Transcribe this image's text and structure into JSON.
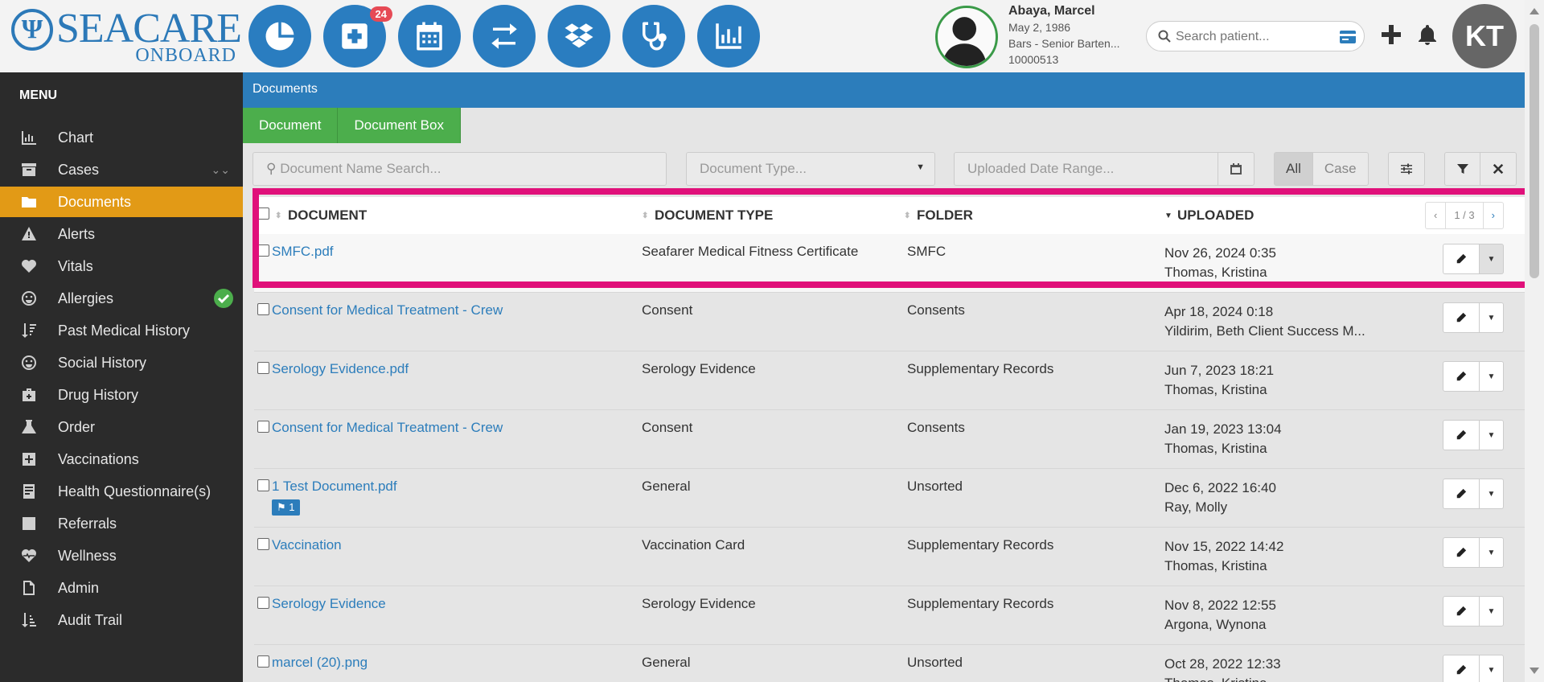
{
  "app": {
    "logo_main": "SEACARE",
    "logo_sub": "ONBOARD",
    "logo_mark": "Ψ",
    "nav_icons": [
      "pie-chart-icon",
      "medical-plus-icon",
      "calendar-icon",
      "transfer-icon",
      "dropbox-icon",
      "stethoscope-icon",
      "bar-chart-icon"
    ],
    "medical_badge_count": "24"
  },
  "patient": {
    "name": "Abaya, Marcel",
    "dob": "May 2, 1986",
    "position": "Bars - Senior Barten...",
    "id": "10000513"
  },
  "header": {
    "search_placeholder": "Search patient...",
    "avatar_initials": "KT"
  },
  "sidebar": {
    "title": "MENU",
    "items": [
      {
        "label": "Chart",
        "icon": "chart-icon"
      },
      {
        "label": "Cases",
        "icon": "archive-icon"
      },
      {
        "label": "Documents",
        "icon": "folder-icon"
      },
      {
        "label": "Alerts",
        "icon": "warning-icon"
      },
      {
        "label": "Vitals",
        "icon": "heart-icon"
      },
      {
        "label": "Allergies",
        "icon": "smile-icon"
      },
      {
        "label": "Past Medical History",
        "icon": "sort-icon"
      },
      {
        "label": "Social History",
        "icon": "smile-icon"
      },
      {
        "label": "Drug History",
        "icon": "medkit-icon"
      },
      {
        "label": "Order",
        "icon": "flask-icon"
      },
      {
        "label": "Vaccinations",
        "icon": "plus-square-icon"
      },
      {
        "label": "Health Questionnaire(s)",
        "icon": "form-icon"
      },
      {
        "label": "Referrals",
        "icon": "referral-icon"
      },
      {
        "label": "Wellness",
        "icon": "heartbeat-icon"
      },
      {
        "label": "Admin",
        "icon": "file-icon"
      },
      {
        "label": "Audit Trail",
        "icon": "sort-amount-icon"
      }
    ]
  },
  "breadcrumb": "Documents",
  "tabs": [
    "Document",
    "Document Box"
  ],
  "filters": {
    "name_placeholder": "Document Name Search...",
    "type_placeholder": "Document Type...",
    "date_placeholder": "Uploaded Date Range...",
    "scope_all": "All",
    "scope_case": "Case"
  },
  "table": {
    "headers": {
      "document": "DOCUMENT",
      "type": "DOCUMENT TYPE",
      "folder": "FOLDER",
      "uploaded": "UPLOADED"
    },
    "pager": {
      "prev": "‹",
      "page": "1 / 3",
      "next": "›"
    },
    "rows": [
      {
        "document": "SMFC.pdf",
        "type": "Seafarer Medical Fitness Certificate",
        "folder": "SMFC",
        "date": "Nov 26, 2024 0:35",
        "user": "Thomas, Kristina",
        "tag": ""
      },
      {
        "document": "Consent for Medical Treatment - Crew",
        "type": "Consent",
        "folder": "Consents",
        "date": "Apr 18, 2024 0:18",
        "user": "Yildirim, Beth Client Success M...",
        "tag": ""
      },
      {
        "document": "Serology Evidence.pdf",
        "type": "Serology Evidence",
        "folder": "Supplementary Records",
        "date": "Jun 7, 2023 18:21",
        "user": "Thomas, Kristina",
        "tag": ""
      },
      {
        "document": "Consent for Medical Treatment - Crew",
        "type": "Consent",
        "folder": "Consents",
        "date": "Jan 19, 2023 13:04",
        "user": "Thomas, Kristina",
        "tag": ""
      },
      {
        "document": "1 Test Document.pdf",
        "type": "General",
        "folder": "Unsorted",
        "date": "Dec 6, 2022 16:40",
        "user": "Ray, Molly",
        "tag": "1"
      },
      {
        "document": "Vaccination",
        "type": "Vaccination Card",
        "folder": "Supplementary Records",
        "date": "Nov 15, 2022 14:42",
        "user": "Thomas, Kristina",
        "tag": ""
      },
      {
        "document": "Serology Evidence",
        "type": "Serology Evidence",
        "folder": "Supplementary Records",
        "date": "Nov 8, 2022 12:55",
        "user": "Argona, Wynona",
        "tag": ""
      },
      {
        "document": "marcel (20).png",
        "type": "General",
        "folder": "Unsorted",
        "date": "Oct 28, 2022 12:33",
        "user": "Thomas, Kristina",
        "tag": ""
      }
    ]
  },
  "colors": {
    "brand_blue": "#2c7dbb",
    "active_orange": "#e29a16",
    "tab_green": "#4cae4c",
    "highlight_pink": "#e0107a"
  }
}
